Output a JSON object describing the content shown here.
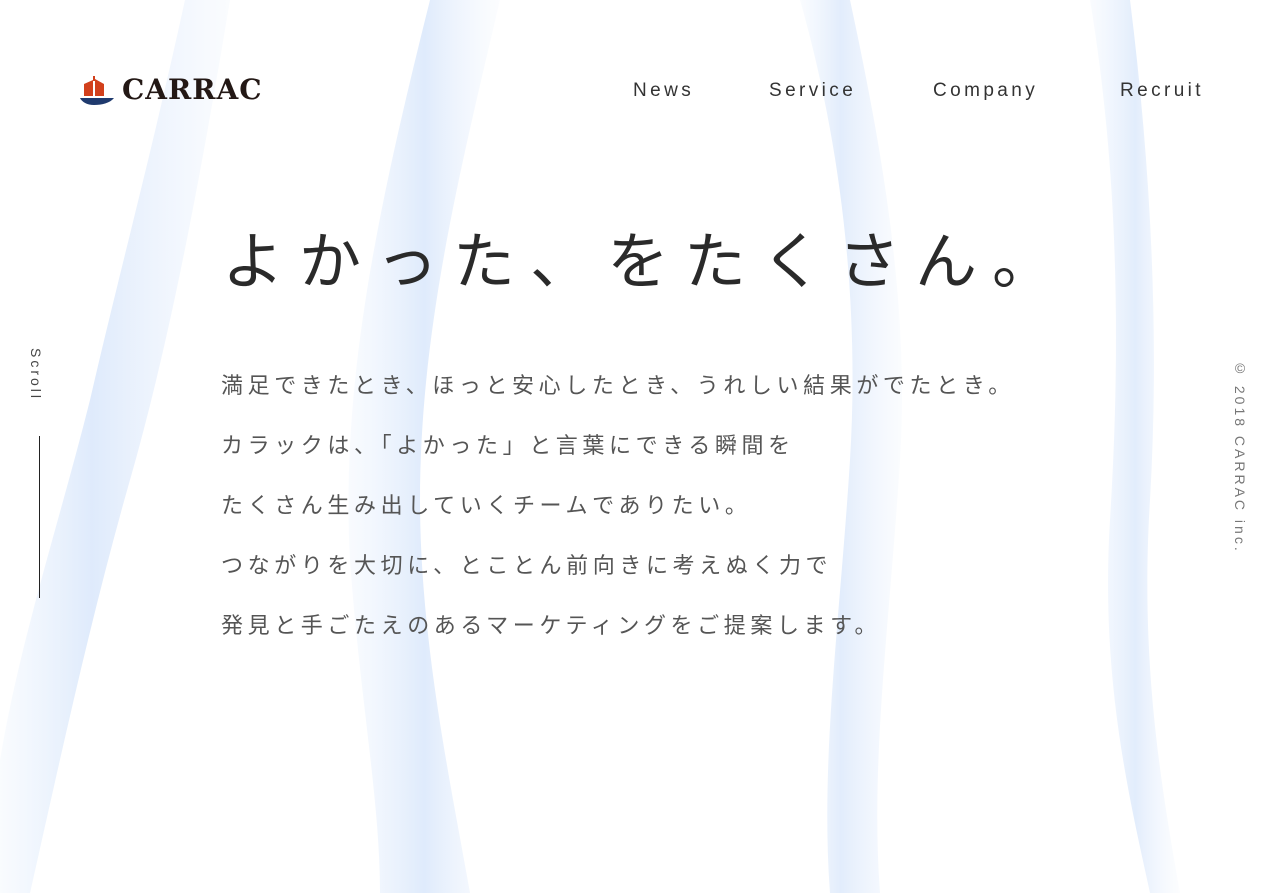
{
  "header": {
    "logo_text": "CARRAC",
    "nav": [
      {
        "label": "News"
      },
      {
        "label": "Service"
      },
      {
        "label": "Company"
      },
      {
        "label": "Recruit"
      }
    ]
  },
  "hero": {
    "title": "よかった、をたくさん。",
    "lines": [
      "満足できたとき、ほっと安心したとき、うれしい結果がでたとき。",
      "カラックは、「よかった」と言葉にできる瞬間を",
      "たくさん生み出していくチームでありたい。",
      "つながりを大切に、とことん前向きに考えぬく力で",
      "発見と手ごたえのあるマーケティングをご提案します。"
    ]
  },
  "scroll": {
    "label": "Scroll"
  },
  "footer": {
    "copyright": "© 2018 CARRAC inc."
  },
  "colors": {
    "logo_red": "#d2401c",
    "logo_navy": "#1f3a6e",
    "logo_text": "#231815",
    "ribbon": "#dce9fb",
    "background": "#ffffff"
  }
}
